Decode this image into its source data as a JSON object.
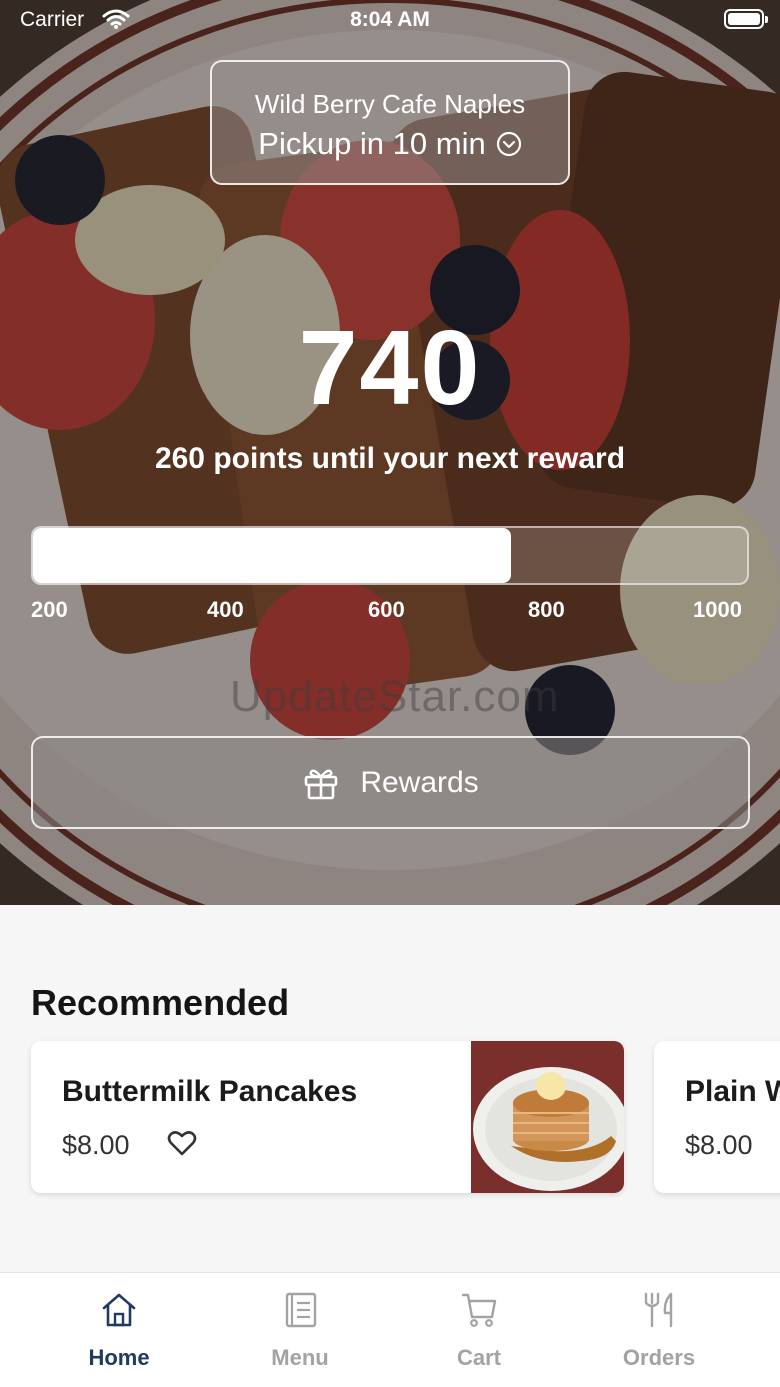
{
  "status_bar": {
    "carrier": "Carrier",
    "time": "8:04 AM"
  },
  "store": {
    "name": "Wild Berry Cafe Naples",
    "pickup": "Pickup in 10 min"
  },
  "rewards": {
    "points": "740",
    "subtitle": "260 points until your next reward",
    "progress_fraction": 0.67,
    "ticks": [
      "200",
      "400",
      "600",
      "800",
      "1000"
    ],
    "button_label": "Rewards"
  },
  "watermark": "UpdateStar.com",
  "recommended": {
    "title": "Recommended",
    "items": [
      {
        "name": "Buttermilk Pancakes",
        "price": "$8.00"
      },
      {
        "name": "Plain W",
        "price": "$8.00"
      }
    ]
  },
  "tabs": [
    {
      "label": "Home",
      "icon": "home-icon",
      "active": true
    },
    {
      "label": "Menu",
      "icon": "menu-icon",
      "active": false
    },
    {
      "label": "Cart",
      "icon": "cart-icon",
      "active": false
    },
    {
      "label": "Orders",
      "icon": "utensils-icon",
      "active": false
    }
  ],
  "colors": {
    "accent": "#1f3a63",
    "inactive_tab": "#a3a3a3",
    "hero_overlay": "#140e0c"
  }
}
